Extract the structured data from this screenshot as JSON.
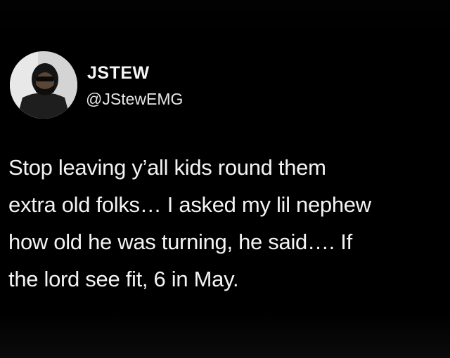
{
  "author": {
    "display_name": "JSTEW",
    "handle": "@JStewEMG",
    "avatar_icon": "profile-photo-avatar-icon"
  },
  "tweet": {
    "lines": [
      "Stop leaving y’all kids round them",
      "extra old folks… I asked my lil nephew",
      "how old he was turning, he said…. If",
      "the lord see fit, 6 in May."
    ]
  },
  "colors": {
    "background": "#000000",
    "text": "#f3f3f3"
  }
}
